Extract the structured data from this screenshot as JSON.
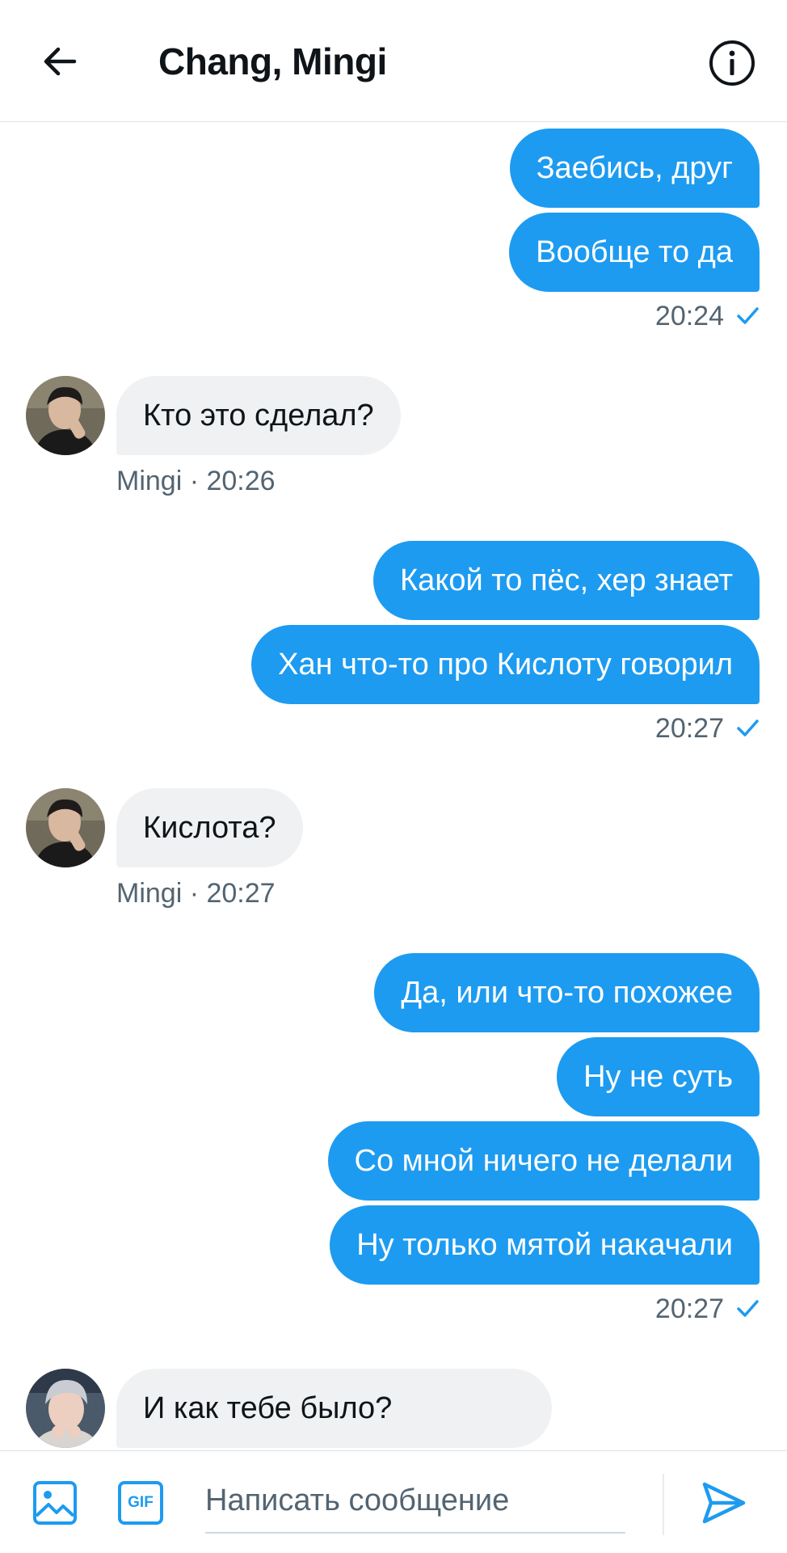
{
  "header": {
    "title": "Chang, Mingi",
    "back_icon": "arrow-left-icon",
    "info_icon": "info-icon"
  },
  "colors": {
    "accent": "#1d9bf0",
    "incoming_bubble": "#eff1f3",
    "muted_text": "#536471"
  },
  "messages": {
    "g1": {
      "m1": "Заебись, друг",
      "m2": "Вообще то да",
      "time": "20:24"
    },
    "r1": {
      "text": "Кто это сделал?",
      "meta": "Mingi · 20:26"
    },
    "g2": {
      "m1": "Какой то пёс, хер знает",
      "m2": "Хан что-то про Кислоту говорил",
      "time": "20:27"
    },
    "r2": {
      "text": "Кислота?",
      "meta": "Mingi · 20:27"
    },
    "g3": {
      "m1": "Да, или что-то похожее",
      "m2": "Ну не суть",
      "m3": "Со мной ничего не делали",
      "m4": "Ну только мятой накачали",
      "time": "20:27"
    },
    "r3": {
      "text": "И как тебе было?"
    }
  },
  "composer": {
    "placeholder": "Написать сообщение",
    "value": "",
    "image_icon": "image-icon",
    "gif_label": "GIF",
    "send_icon": "send-icon"
  }
}
